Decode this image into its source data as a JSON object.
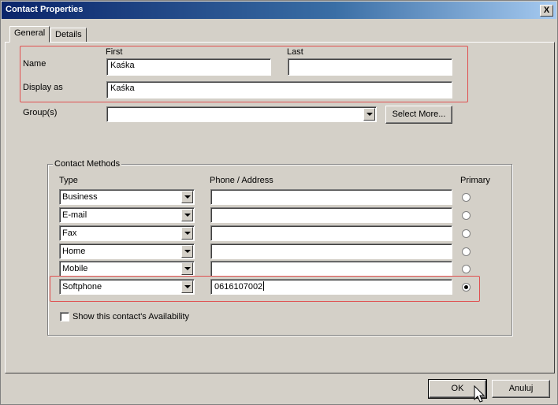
{
  "window": {
    "title": "Contact Properties",
    "close_glyph": "X"
  },
  "tabs": [
    {
      "label": "General",
      "active": true
    },
    {
      "label": "Details",
      "active": false
    }
  ],
  "name_section": {
    "name_label": "Name",
    "first_label": "First",
    "last_label": "Last",
    "first_value": "Kaśka",
    "last_value": "",
    "display_label": "Display as",
    "display_value": "Kaśka"
  },
  "groups": {
    "label": "Group(s)",
    "value": "",
    "select_more_label": "Select More..."
  },
  "contact_methods": {
    "legend": "Contact Methods",
    "type_header": "Type",
    "address_header": "Phone / Address",
    "primary_header": "Primary",
    "rows": [
      {
        "type": "Business",
        "address": "",
        "primary": false
      },
      {
        "type": "E-mail",
        "address": "",
        "primary": false
      },
      {
        "type": "Fax",
        "address": "",
        "primary": false
      },
      {
        "type": "Home",
        "address": "",
        "primary": false
      },
      {
        "type": "Mobile",
        "address": "",
        "primary": false
      },
      {
        "type": "Softphone",
        "address": "0616107002",
        "primary": true
      }
    ],
    "availability_label": "Show this contact's Availability",
    "availability_checked": false
  },
  "footer": {
    "ok_label": "OK",
    "cancel_label": "Anuluj"
  },
  "colors": {
    "highlight": "#e05050",
    "titlebar_start": "#0a246a",
    "titlebar_end": "#a6caf0",
    "face": "#d4d0c8"
  }
}
